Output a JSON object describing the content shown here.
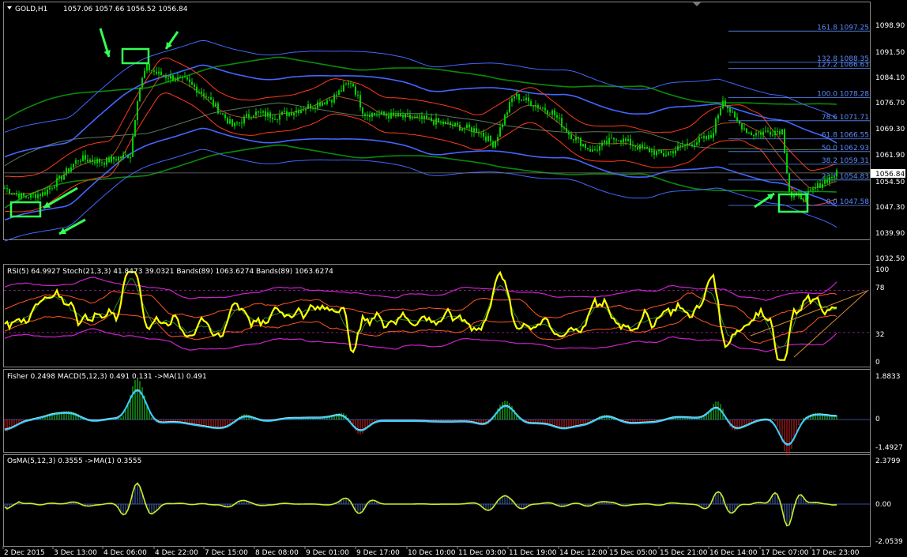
{
  "header": {
    "symbol": "GOLD,H1",
    "ohlc": "1057.06 1057.66 1056.52 1056.84"
  },
  "price_axis": {
    "labels": [
      "1098.90",
      "1091.50",
      "1084.10",
      "1076.70",
      "1069.30",
      "1061.90",
      "1054.50",
      "1047.30",
      "1039.90",
      "1032.50"
    ],
    "current": "1056.84"
  },
  "fib_levels": [
    {
      "label": "161.8 1097.25",
      "price": 1097.25
    },
    {
      "label": "132.8 1088.35",
      "price": 1088.35
    },
    {
      "label": "127.2 1086.63",
      "price": 1086.63
    },
    {
      "label": "100.0 1078.28",
      "price": 1078.28
    },
    {
      "label": "78.6 1071.71",
      "price": 1071.71
    },
    {
      "label": "61.8 1066.55",
      "price": 1066.55
    },
    {
      "label": "50.0 1062.93",
      "price": 1062.93
    },
    {
      "label": "38.2 1059.31",
      "price": 1059.31
    },
    {
      "label": "23.6 1054.83",
      "price": 1054.83
    },
    {
      "label": "0.0 1047.58",
      "price": 1047.58
    }
  ],
  "panels": {
    "rsi": {
      "title": "RSI(5) 64.9927  Stoch(21,3,3) 41.8473 39.0321  Bands(89) 1063.6274  Bands(89) 1063.6274",
      "axis": [
        "100",
        "78",
        "32",
        "0"
      ]
    },
    "macd": {
      "title": "Fisher 0.2498  MACD(5,12,3) 0.491 0.131  ->MA(1) 0.491",
      "axis": [
        "1.8833",
        "0",
        "-1.4927"
      ]
    },
    "osma": {
      "title": "OsMA(5,12,3) 0.3555  ->MA(1) 0.3555",
      "axis": [
        "2.3799",
        "0.00",
        "-2.0539"
      ]
    }
  },
  "time_axis": [
    "2 Dec 2015",
    "3 Dec 13:00",
    "4 Dec 06:00",
    "4 Dec 22:00",
    "7 Dec 15:00",
    "8 Dec 08:00",
    "9 Dec 01:00",
    "9 Dec 17:00",
    "10 Dec 10:00",
    "11 Dec 03:00",
    "11 Dec 19:00",
    "14 Dec 12:00",
    "15 Dec 05:00",
    "15 Dec 21:00",
    "16 Dec 14:00",
    "17 Dec 07:00",
    "17 Dec 23:00"
  ],
  "colors": {
    "background": "#000000",
    "candle": "#00d000",
    "bands_blue": "#4466ff",
    "bands_green": "#0a8a0a",
    "bands_red": "#ff3a1a",
    "rsi": "#ffff00",
    "fisher": "#33ccff",
    "macd_up": "#22dd22",
    "macd_down": "#dd2222",
    "osma": "#ccee22",
    "highlight": "#33ff55",
    "fib": "#5b8cff"
  },
  "chart_data": {
    "type": "line",
    "title": "GOLD,H1",
    "x": [
      "2 Dec 2015",
      "3 Dec 13:00",
      "4 Dec 06:00",
      "4 Dec 22:00",
      "7 Dec 15:00",
      "8 Dec 08:00",
      "9 Dec 01:00",
      "9 Dec 17:00",
      "10 Dec 10:00",
      "11 Dec 03:00",
      "11 Dec 19:00",
      "14 Dec 12:00",
      "15 Dec 05:00",
      "15 Dec 21:00",
      "16 Dec 14:00",
      "17 Dec 07:00",
      "17 Dec 23:00"
    ],
    "series": [
      {
        "name": "GOLD,H1",
        "values": [
          1052.5,
          1061.0,
          1058.5,
          1083.5,
          1072.0,
          1069.5,
          1077.0,
          1075.0,
          1071.5,
          1064.5,
          1076.0,
          1064.0,
          1062.0,
          1063.5,
          1077.0,
          1050.0,
          1056.84
        ]
      }
    ],
    "ylim": [
      1032.5,
      1101.0
    ]
  }
}
